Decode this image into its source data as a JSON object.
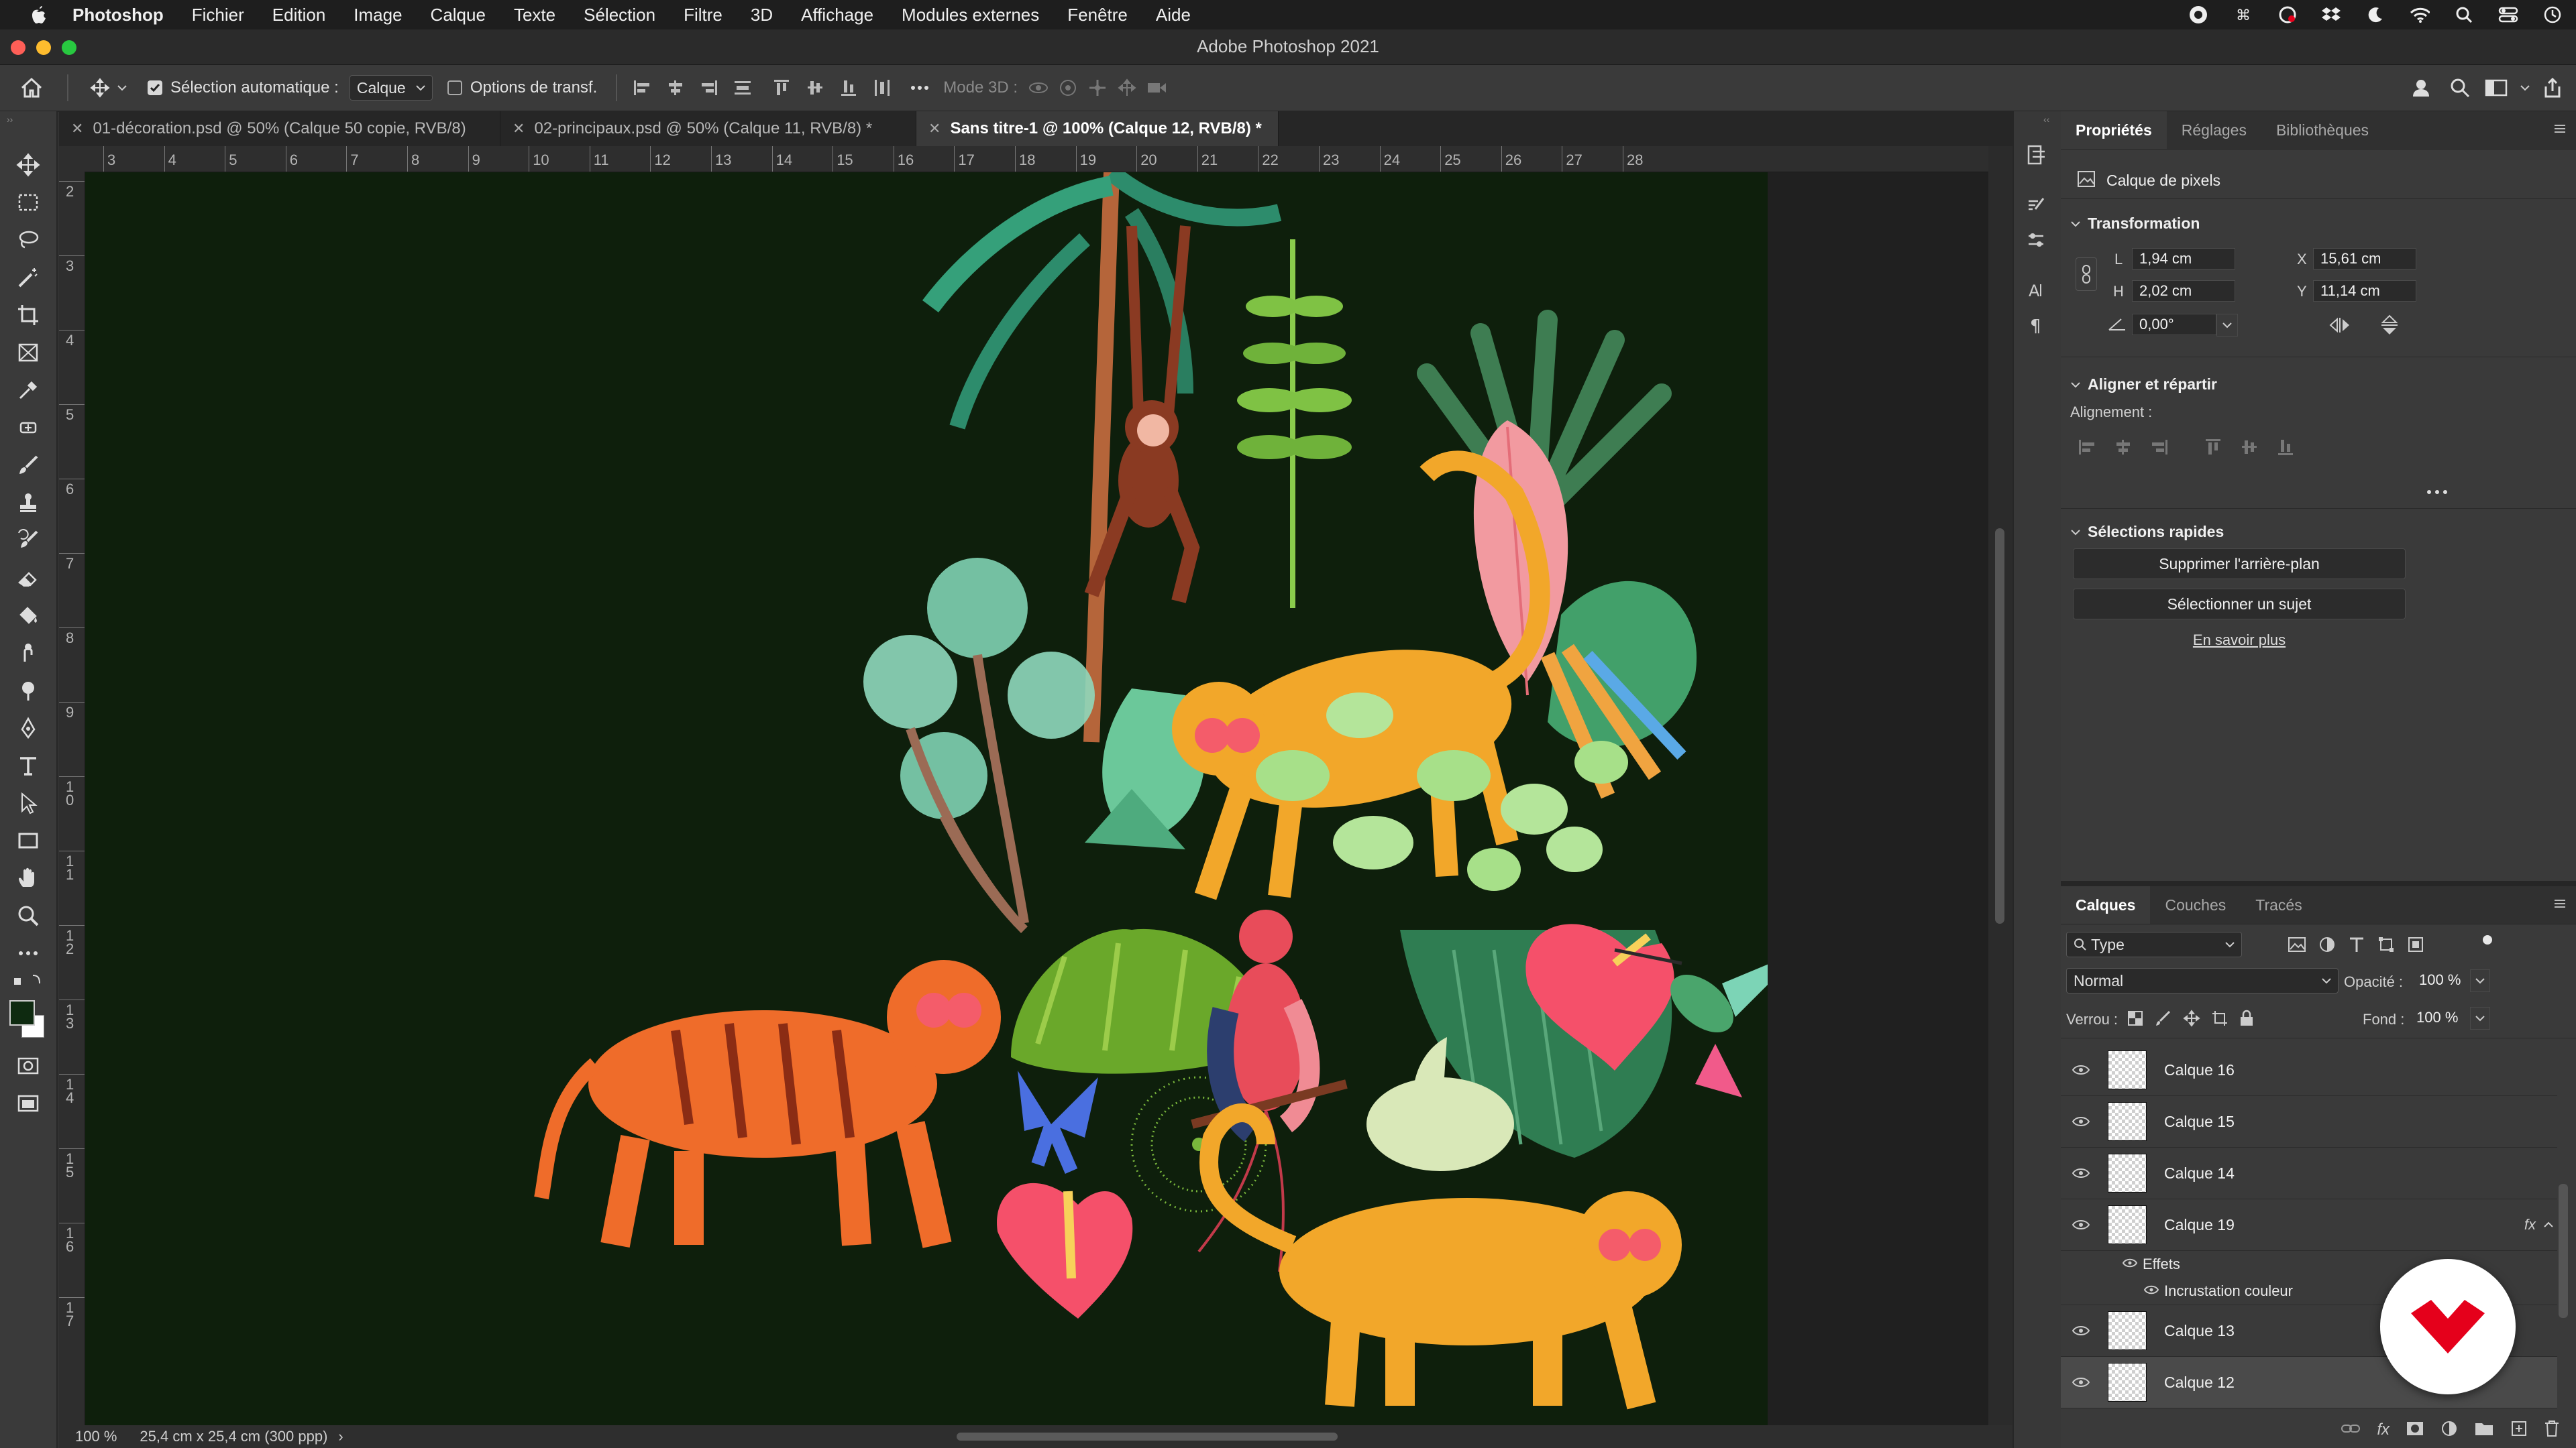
{
  "menubar": {
    "app_name": "Photoshop",
    "items": [
      "Fichier",
      "Edition",
      "Image",
      "Calque",
      "Texte",
      "Sélection",
      "Filtre",
      "3D",
      "Affichage",
      "Modules externes",
      "Fenêtre",
      "Aide"
    ]
  },
  "window": {
    "title": "Adobe Photoshop 2021"
  },
  "options_bar": {
    "auto_select_label": "Sélection automatique :",
    "auto_select_checked": true,
    "auto_select_value": "Calque",
    "transform_options_label": "Options de transf.",
    "mode_3d_label": "Mode 3D :"
  },
  "tabs": [
    {
      "label": "01-décoration.psd @ 50% (Calque 50 copie, RVB/8)",
      "active": false
    },
    {
      "label": "02-principaux.psd @ 50% (Calque 11, RVB/8) *",
      "active": false
    },
    {
      "label": "Sans titre-1 @ 100% (Calque 12, RVB/8) *",
      "active": true
    }
  ],
  "rulers": {
    "horizontal": [
      "3",
      "4",
      "5",
      "6",
      "7",
      "8",
      "9",
      "10",
      "11",
      "12",
      "13",
      "14",
      "15",
      "16",
      "17",
      "18",
      "19",
      "20",
      "21",
      "22",
      "23",
      "24",
      "25",
      "26",
      "27",
      "28"
    ],
    "vertical": [
      "2",
      "3",
      "4",
      "5",
      "6",
      "7",
      "8",
      "9",
      "1 0",
      "1 1",
      "1 2",
      "1 3",
      "1 4",
      "1 5",
      "1 6",
      "1 7"
    ]
  },
  "status_bar": {
    "zoom": "100 %",
    "doc_info": "25,4 cm x 25,4 cm (300 ppp)",
    "arrow": "›"
  },
  "colors": {
    "foreground": "#0e2a10",
    "background": "#ffffff",
    "canvas_bg": "#0e1f0c",
    "accent_red": "#e5001b"
  },
  "properties_panel": {
    "tabs": [
      "Propriétés",
      "Réglages",
      "Bibliothèques"
    ],
    "layer_kind": "Calque de pixels",
    "transform": {
      "title": "Transformation",
      "w_label": "L",
      "w_value": "1,94 cm",
      "h_label": "H",
      "h_value": "2,02 cm",
      "x_label": "X",
      "x_value": "15,61 cm",
      "y_label": "Y",
      "y_value": "11,14 cm",
      "angle_value": "0,00°"
    },
    "align": {
      "title": "Aligner et répartir",
      "alignment_label": "Alignement :"
    },
    "quick_actions": {
      "title": "Sélections rapides",
      "remove_bg": "Supprimer l'arrière-plan",
      "select_subject": "Sélectionner un sujet",
      "learn_more": "En savoir plus"
    }
  },
  "layers_panel": {
    "tabs": [
      "Calques",
      "Couches",
      "Tracés"
    ],
    "filter_value": "Type",
    "blend_mode": "Normal",
    "opacity_label": "Opacité :",
    "opacity_value": "100 %",
    "lock_label": "Verrou :",
    "fill_label": "Fond :",
    "fill_value": "100 %",
    "layers": [
      {
        "name": "Calque 16",
        "visible": true,
        "selected": false
      },
      {
        "name": "Calque 15",
        "visible": true,
        "selected": false
      },
      {
        "name": "Calque 14",
        "visible": true,
        "selected": false
      },
      {
        "name": "Calque 19",
        "visible": true,
        "selected": false,
        "fx": "fx"
      },
      {
        "name": "Calque 13",
        "visible": true,
        "selected": false
      },
      {
        "name": "Calque 12",
        "visible": true,
        "selected": true
      }
    ],
    "effects_label": "Effets",
    "effect_item": "Incrustation couleur"
  }
}
